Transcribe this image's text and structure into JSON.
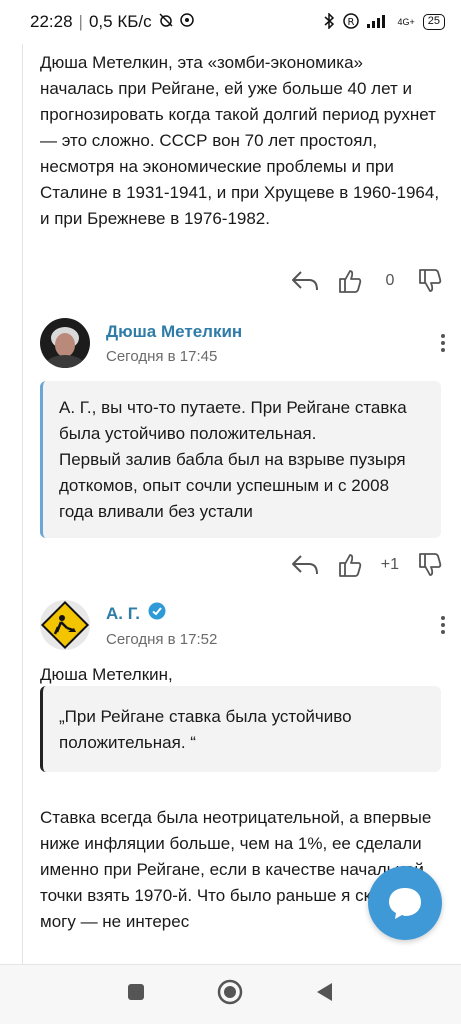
{
  "status_bar": {
    "time": "22:28",
    "speed": "0,5 КБ/с",
    "network": "4G+",
    "battery": "25",
    "icons": [
      "alarm-off-icon",
      "app-icon",
      "bluetooth-icon",
      "registered-icon",
      "signal-icon"
    ]
  },
  "post_text": "Дюша Метелкин, эта «зомби-экономика» началась при Рейгане, ей уже больше 40 лет и прогнозировать когда такой долгий период рухнет — это сложно. СССР вон 70 лет простоял, несмотря на экономические проблемы и при Сталине в 1931-1941, и при Хрущеве в 1960-1964, и при  Брежневе в 1976-1982.",
  "post_actions": {
    "likes": "0"
  },
  "comment1": {
    "author": "Дюша Метелкин",
    "time": "Сегодня в 17:45",
    "quote": "А. Г., вы что-то путаете. При Рейгане ставка была устойчиво положительная.\nПервый залив бабла был на взрыве пузыря доткомов, опыт сочли успешным и с 2008 года вливали без устали",
    "likes": "+1"
  },
  "comment2": {
    "author": "А. Г.",
    "verified": true,
    "time": "Сегодня в 17:52",
    "addressee": "Дюша Метелкин,",
    "quote": "„При Рейгане ставка была устойчиво положительная. “",
    "text": "Ставка всегда была неотрицательной, а впервые ниже инфляции больше, чем на 1%, ее сделали именно при Рейгане, если в качестве начальной точки взять 1970-й. Что было раньше я сказать не могу — не интерес"
  },
  "colors": {
    "accent": "#2f7ca8",
    "fab": "#3f99d6",
    "quote_border": "#6aa7d6"
  }
}
